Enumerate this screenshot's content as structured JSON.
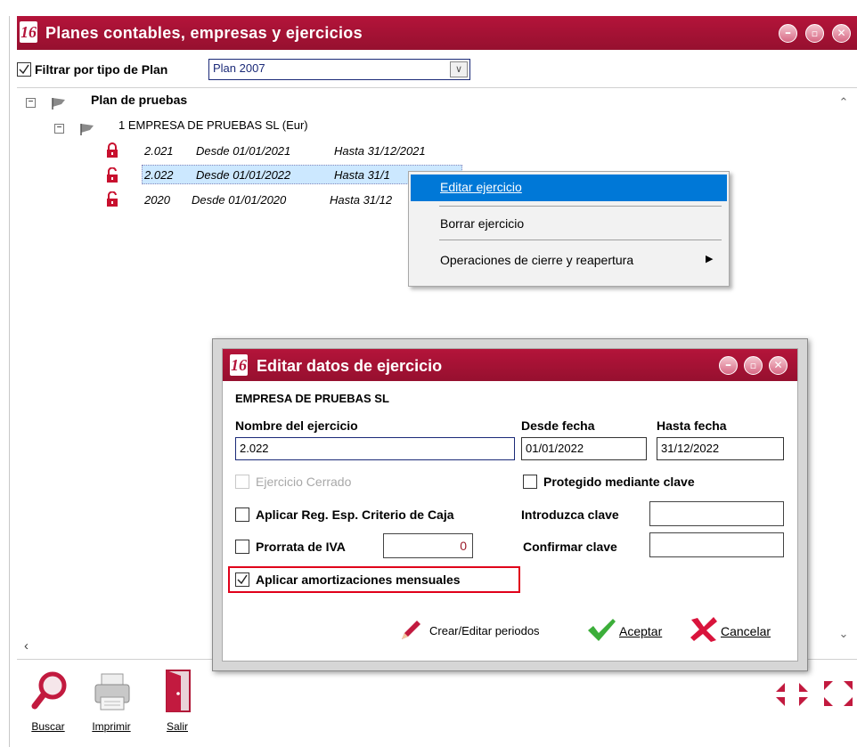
{
  "main_window": {
    "title": "Planes contables, empresas y ejercicios",
    "logo": "16",
    "filter": {
      "label": "Filtrar por tipo de Plan",
      "checked": true,
      "select_value": "Plan 2007"
    },
    "tree": {
      "plan": "Plan de pruebas",
      "company": "1 EMPRESA DE PRUEBAS SL (Eur)",
      "exercises": [
        {
          "name": "2.021",
          "from": "Desde 01/01/2021",
          "to": "Hasta 31/12/2021",
          "lock": "locked"
        },
        {
          "name": "2.022",
          "from": "Desde 01/01/2022",
          "to": "Hasta 31/1",
          "lock": "unlocked",
          "selected": true
        },
        {
          "name": "2020",
          "from": "Desde 01/01/2020",
          "to": "Hasta 31/12",
          "lock": "unlocked"
        }
      ]
    },
    "toolbar": {
      "search": "Buscar",
      "print": "Imprimir",
      "exit": "Salir"
    }
  },
  "context_menu": {
    "items": [
      "Editar ejercicio",
      "Borrar ejercicio",
      "Operaciones de cierre y reapertura"
    ]
  },
  "dialog": {
    "title": "Editar datos de ejercicio",
    "logo": "16",
    "company": "EMPRESA DE PRUEBAS SL",
    "name_label": "Nombre del ejercicio",
    "name_value": "2.022",
    "from_label": "Desde fecha",
    "from_value": "01/01/2022",
    "to_label": "Hasta fecha",
    "to_value": "31/12/2022",
    "closed_label": "Ejercicio Cerrado",
    "protected_label": "Protegido mediante clave",
    "cash_label": "Aplicar Reg. Esp. Criterio de Caja",
    "enter_key_label": "Introduzca clave",
    "prorrata_label": "Prorrata de IVA",
    "prorrata_value": "0",
    "confirm_key_label": "Confirmar clave",
    "amort_label": "Aplicar amortizaciones mensuales",
    "amort_checked": true,
    "periods_button": "Crear/Editar periodos",
    "accept_button": "Aceptar",
    "cancel_button": "Cancelar"
  },
  "colors": {
    "title_bar": "#b4143a",
    "selection": "#cce8ff",
    "menu_highlight": "#0078d7",
    "highlight_border": "#e0001a"
  }
}
